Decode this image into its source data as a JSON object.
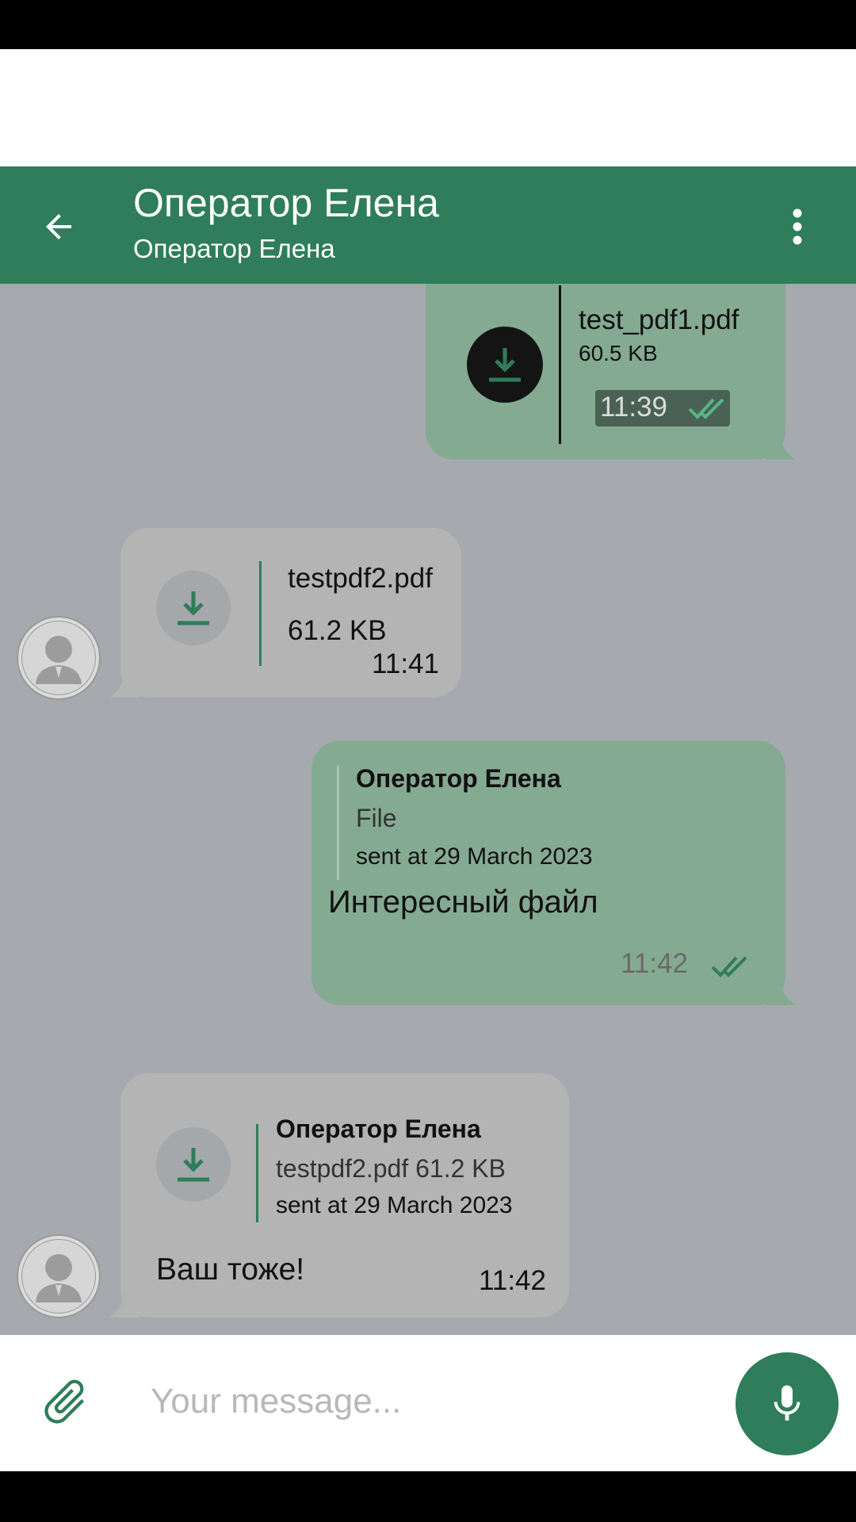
{
  "header": {
    "title": "Оператор Елена",
    "subtitle": "Оператор Елена"
  },
  "messages": [
    {
      "direction": "outgoing",
      "type": "file",
      "file_name": "test_pdf1.pdf",
      "file_size": "60.5 KB",
      "time": "11:39",
      "status": "read"
    },
    {
      "direction": "incoming",
      "type": "file",
      "file_name": "testpdf2.pdf",
      "file_size": "61.2 KB",
      "time": "11:41"
    },
    {
      "direction": "outgoing",
      "type": "reply",
      "quote_author": "Оператор Елена",
      "quote_text": "File",
      "quote_date": "sent at 29 March 2023",
      "text": "Интересный файл",
      "time": "11:42",
      "status": "read"
    },
    {
      "direction": "incoming",
      "type": "reply",
      "quote_author": "Оператор Елена",
      "quote_text": "testpdf2.pdf 61.2 KB",
      "quote_date": "sent at 29 March 2023",
      "text": "Ваш тоже!",
      "time": "11:42"
    }
  ],
  "composer": {
    "placeholder": "Your message..."
  },
  "icons": {
    "back": "arrow-left-icon",
    "menu": "more-vertical-icon",
    "download": "download-icon",
    "read": "double-check-icon",
    "avatar": "person-icon",
    "attach": "paperclip-icon",
    "mic": "microphone-icon"
  },
  "colors": {
    "primary": "#2f7d5a",
    "chat_background": "#a6aaae",
    "outgoing_bubble": "#85aa92",
    "incoming_bubble": "#b4b4b4"
  }
}
